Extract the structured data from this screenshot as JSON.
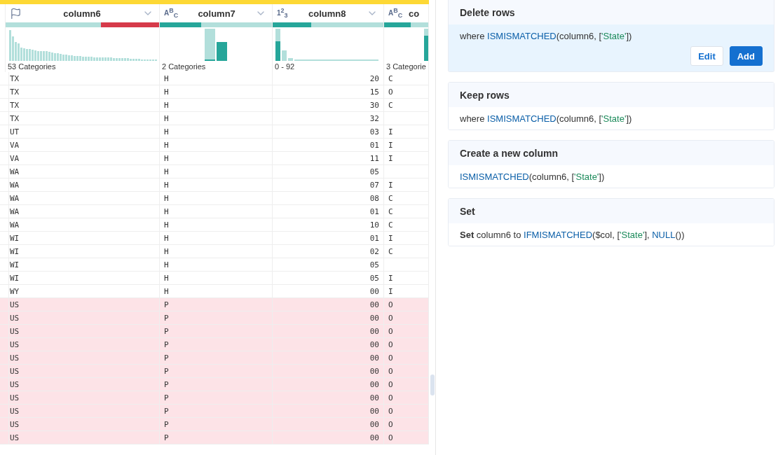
{
  "columns": [
    {
      "name": "column6",
      "kind": "flag",
      "summary": "53 Categories",
      "level": 0.62,
      "mismatched": true,
      "menu": true
    },
    {
      "name": "column7",
      "kind": "text",
      "type_label": "A$^{B}$$_{C}$",
      "summary": "2 Categories",
      "level": 0.37,
      "mismatched": false,
      "menu": true
    },
    {
      "name": "column8",
      "kind": "number",
      "type_label": "1$^{2}$$_{3}$",
      "summary": "0 - 92",
      "level": 0.35,
      "mismatched": false,
      "menu": true
    },
    {
      "name": "co",
      "kind": "text",
      "type_label": "A$^{B}$$_{C}$",
      "summary": "3 Categorie",
      "level": 0.6,
      "mismatched": false,
      "menu": false
    }
  ],
  "rows": [
    {
      "cells": [
        "TX",
        "H",
        "20",
        "C"
      ],
      "mismatched": false
    },
    {
      "cells": [
        "TX",
        "H",
        "15",
        "O"
      ],
      "mismatched": false
    },
    {
      "cells": [
        "TX",
        "H",
        "30",
        "C"
      ],
      "mismatched": false
    },
    {
      "cells": [
        "TX",
        "H",
        "32",
        ""
      ],
      "mismatched": false
    },
    {
      "cells": [
        "UT",
        "H",
        "03",
        "I"
      ],
      "mismatched": false
    },
    {
      "cells": [
        "VA",
        "H",
        "01",
        "I"
      ],
      "mismatched": false
    },
    {
      "cells": [
        "VA",
        "H",
        "11",
        "I"
      ],
      "mismatched": false
    },
    {
      "cells": [
        "WA",
        "H",
        "05",
        ""
      ],
      "mismatched": false
    },
    {
      "cells": [
        "WA",
        "H",
        "07",
        "I"
      ],
      "mismatched": false
    },
    {
      "cells": [
        "WA",
        "H",
        "08",
        "C"
      ],
      "mismatched": false
    },
    {
      "cells": [
        "WA",
        "H",
        "01",
        "C"
      ],
      "mismatched": false
    },
    {
      "cells": [
        "WA",
        "H",
        "10",
        "C"
      ],
      "mismatched": false
    },
    {
      "cells": [
        "WI",
        "H",
        "01",
        "I"
      ],
      "mismatched": false
    },
    {
      "cells": [
        "WI",
        "H",
        "02",
        "C"
      ],
      "mismatched": false
    },
    {
      "cells": [
        "WI",
        "H",
        "05",
        ""
      ],
      "mismatched": false
    },
    {
      "cells": [
        "WI",
        "H",
        "05",
        "I"
      ],
      "mismatched": false
    },
    {
      "cells": [
        "WY",
        "H",
        "00",
        "I"
      ],
      "mismatched": false
    },
    {
      "cells": [
        "US",
        "P",
        "00",
        "O"
      ],
      "mismatched": true
    },
    {
      "cells": [
        "US",
        "P",
        "00",
        "O"
      ],
      "mismatched": true
    },
    {
      "cells": [
        "US",
        "P",
        "00",
        "O"
      ],
      "mismatched": true
    },
    {
      "cells": [
        "US",
        "P",
        "00",
        "O"
      ],
      "mismatched": true
    },
    {
      "cells": [
        "US",
        "P",
        "00",
        "O"
      ],
      "mismatched": true
    },
    {
      "cells": [
        "US",
        "P",
        "00",
        "O"
      ],
      "mismatched": true
    },
    {
      "cells": [
        "US",
        "P",
        "00",
        "O"
      ],
      "mismatched": true
    },
    {
      "cells": [
        "US",
        "P",
        "00",
        "O"
      ],
      "mismatched": true
    },
    {
      "cells": [
        "US",
        "P",
        "00",
        "O"
      ],
      "mismatched": true
    },
    {
      "cells": [
        "US",
        "P",
        "00",
        "O"
      ],
      "mismatched": true
    },
    {
      "cells": [
        "US",
        "P",
        "00",
        "O"
      ],
      "mismatched": true
    }
  ],
  "suggestions": [
    {
      "title": "Delete rows",
      "selected": true,
      "expression": [
        {
          "kind": "plain",
          "text": "where "
        },
        {
          "kind": "function",
          "text": "ISMISMATCHED"
        },
        {
          "kind": "plain",
          "text": "(column6, ["
        },
        {
          "kind": "string",
          "text": "'State'"
        },
        {
          "kind": "plain",
          "text": "])"
        }
      ],
      "buttons": [
        {
          "label": "Edit",
          "kind": "secondary"
        },
        {
          "label": "Add",
          "kind": "primary"
        }
      ]
    },
    {
      "title": "Keep rows",
      "selected": false,
      "expression": [
        {
          "kind": "plain",
          "text": "where "
        },
        {
          "kind": "function",
          "text": "ISMISMATCHED"
        },
        {
          "kind": "plain",
          "text": "(column6, ["
        },
        {
          "kind": "string",
          "text": "'State'"
        },
        {
          "kind": "plain",
          "text": "])"
        }
      ]
    },
    {
      "title": "Create a new column",
      "selected": false,
      "expression": [
        {
          "kind": "function",
          "text": "ISMISMATCHED"
        },
        {
          "kind": "plain",
          "text": "(column6, ["
        },
        {
          "kind": "string",
          "text": "'State'"
        },
        {
          "kind": "plain",
          "text": "])"
        }
      ]
    },
    {
      "title": "Set",
      "selected": false,
      "expression": [
        {
          "kind": "keyword",
          "text": "Set"
        },
        {
          "kind": "plain",
          "text": " column6 to "
        },
        {
          "kind": "function",
          "text": "IFMISMATCHED"
        },
        {
          "kind": "plain",
          "text": "($col, ["
        },
        {
          "kind": "string",
          "text": "'State'"
        },
        {
          "kind": "plain",
          "text": "], "
        },
        {
          "kind": "function",
          "text": "NULL"
        },
        {
          "kind": "plain",
          "text": "())"
        }
      ]
    }
  ]
}
